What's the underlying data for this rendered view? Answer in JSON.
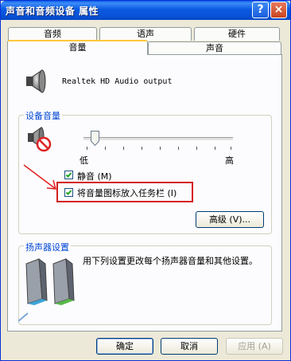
{
  "window": {
    "title": "声音和音频设备 属性"
  },
  "tabs": {
    "row1": [
      "音频",
      "语声",
      "硬件"
    ],
    "row2": [
      "音量",
      "声音"
    ],
    "active": "音量"
  },
  "device": {
    "name": "Realtek HD Audio output"
  },
  "device_volume": {
    "group_title": "设备音量",
    "low_label": "低",
    "high_label": "高",
    "volume_level": 0.05,
    "mute": {
      "label": "静音 (M)",
      "checked": true
    },
    "tray_icon": {
      "label": "将音量图标放入任务栏 (I)",
      "checked": true
    },
    "advanced_button": "高级 (V)..."
  },
  "speaker_settings": {
    "group_title": "扬声器设置",
    "description": "用下列设置更改每个扬声器音量和其他设置。"
  },
  "buttons": {
    "ok": "确定",
    "cancel": "取消",
    "apply": "应用 (A)"
  },
  "colors": {
    "title_bar": "#0b5ae2",
    "highlight_box": "#d42020",
    "group_title": "#0046d5"
  }
}
